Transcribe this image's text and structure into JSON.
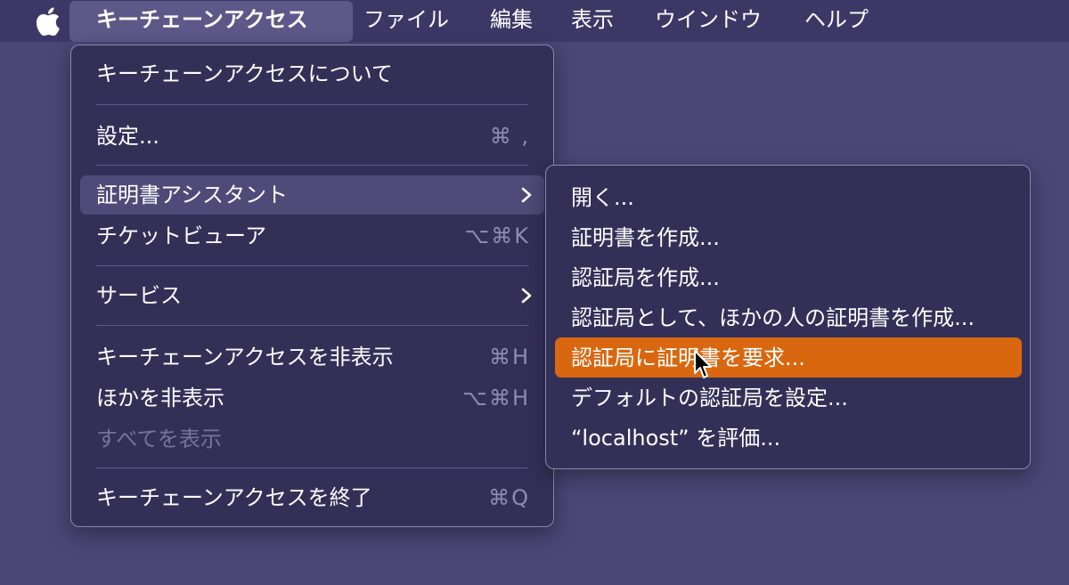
{
  "menubar": {
    "app_name": "キーチェーンアクセス",
    "items": [
      "ファイル",
      "編集",
      "表示",
      "ウインドウ",
      "ヘルプ"
    ]
  },
  "app_menu": {
    "about": "キーチェーンアクセスについて",
    "settings": {
      "label": "設定...",
      "shortcut": "⌘ ,"
    },
    "cert_assistant": "証明書アシスタント",
    "ticket_viewer": {
      "label": "チケットビューア",
      "shortcut": "⌥⌘K"
    },
    "services": "サービス",
    "hide_app": {
      "label": "キーチェーンアクセスを非表示",
      "shortcut": "⌘H"
    },
    "hide_others": {
      "label": "ほかを非表示",
      "shortcut": "⌥⌘H"
    },
    "show_all": "すべてを表示",
    "quit": {
      "label": "キーチェーンアクセスを終了",
      "shortcut": "⌘Q"
    }
  },
  "cert_submenu": {
    "items": [
      "開く...",
      "証明書を作成...",
      "認証局を作成...",
      "認証局として、ほかの人の証明書を作成...",
      "認証局に証明書を要求...",
      "デフォルトの認証局を設定...",
      "“localhost” を評価..."
    ],
    "highlighted_index": 4
  },
  "colors": {
    "background": "#4a4676",
    "menubar": "#3c3866",
    "menu": "#333058",
    "highlight": "#d9670f"
  },
  "icons": [
    "apple-logo-icon",
    "chevron-right-icon",
    "pointer-cursor-icon"
  ]
}
